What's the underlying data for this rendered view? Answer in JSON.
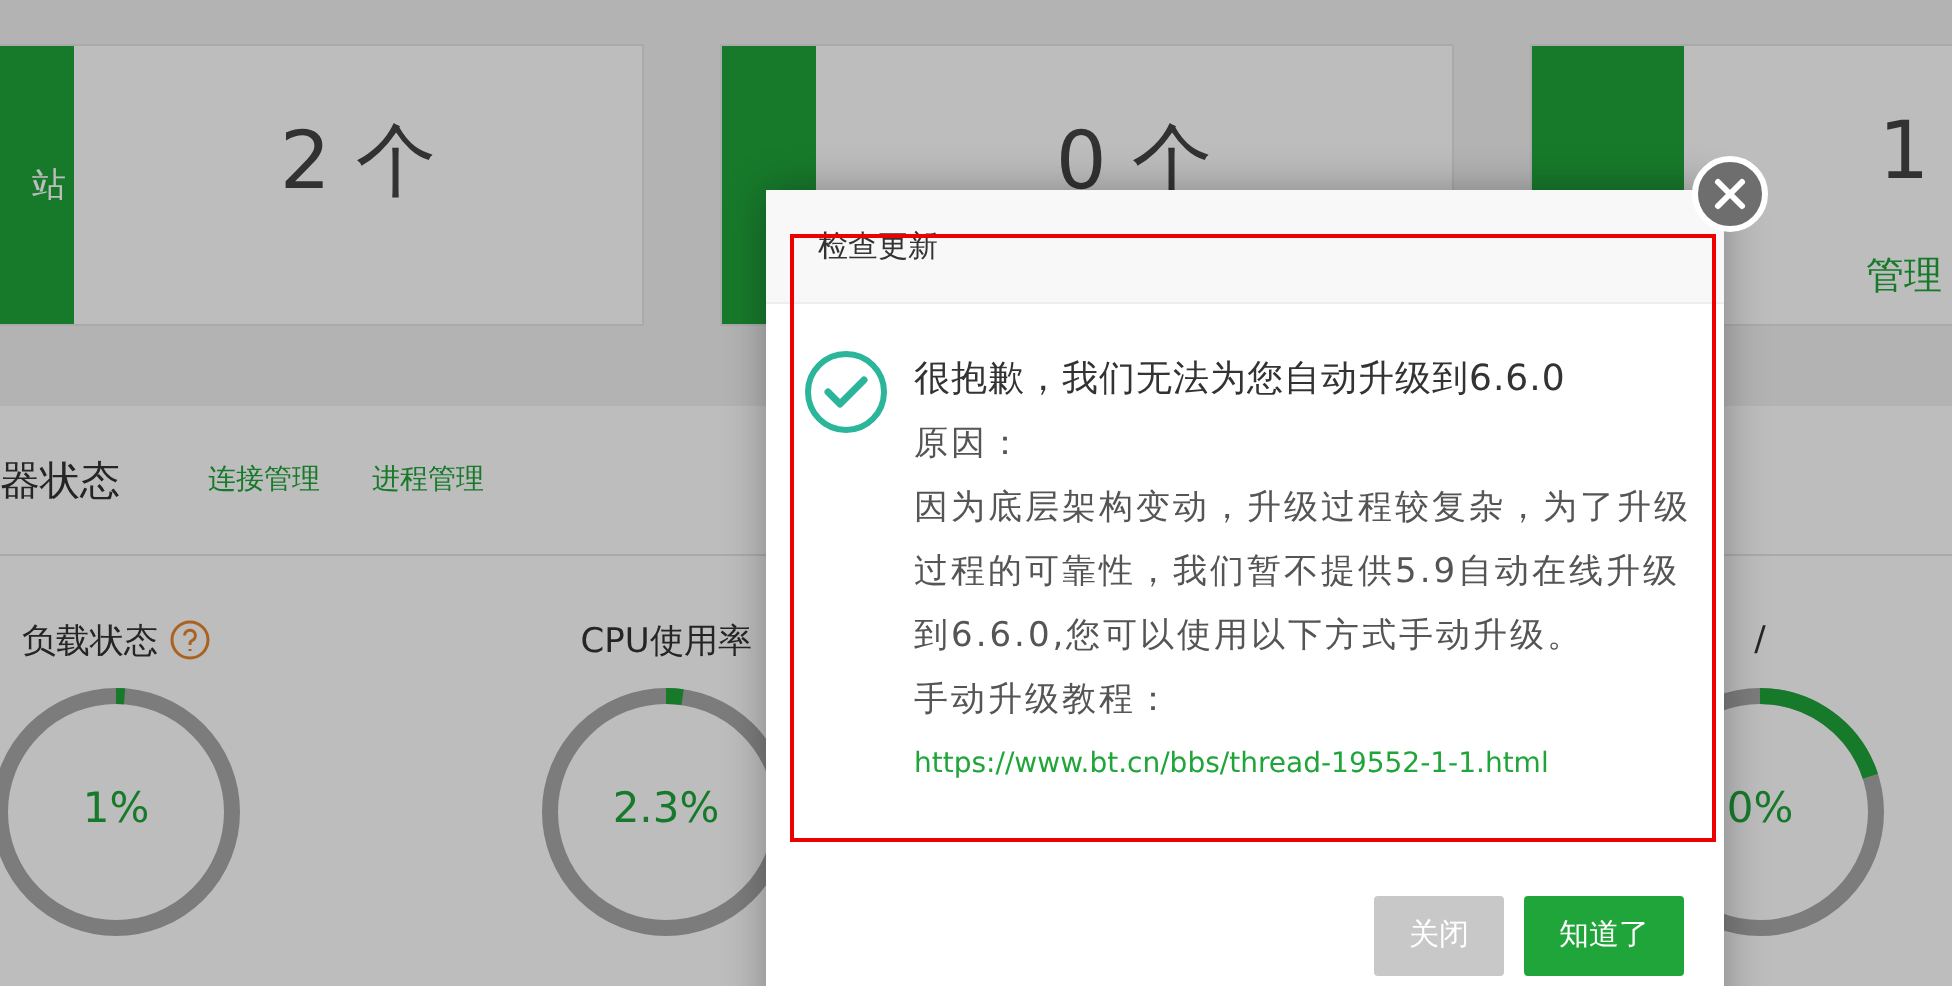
{
  "stat_cards": [
    {
      "label": "站",
      "count": "2 个"
    },
    {
      "count": "0 个"
    },
    {
      "count": "1",
      "link": "管理"
    }
  ],
  "status_panel": {
    "title": "器状态",
    "links": [
      "连接管理",
      "进程管理"
    ],
    "gauges": [
      {
        "label": "负载状态",
        "help": true,
        "level": 0.01,
        "value": "1%"
      },
      {
        "label": "CPU使用率",
        "help": false,
        "level": 0.023,
        "value": "2.3%"
      },
      {
        "label": "/",
        "help": false,
        "level": 0.2,
        "value": "0%"
      }
    ]
  },
  "dialog": {
    "title": "检查更新",
    "headline": "很抱歉，我们无法为您自动升级到6.6.0",
    "reason_label": "原因：",
    "reason": "因为底层架构变动，升级过程较复杂，为了升级过程的可靠性，我们暂不提供5.9自动在线升级到6.6.0,您可以使用以下方式手动升级。",
    "tutorial_label": "手动升级教程：",
    "link": "https://www.bt.cn/bbs/thread-19552-1-1.html",
    "buttons": [
      {
        "label": "关闭",
        "kind": "secondary"
      },
      {
        "label": "知道了",
        "kind": "primary"
      }
    ]
  }
}
